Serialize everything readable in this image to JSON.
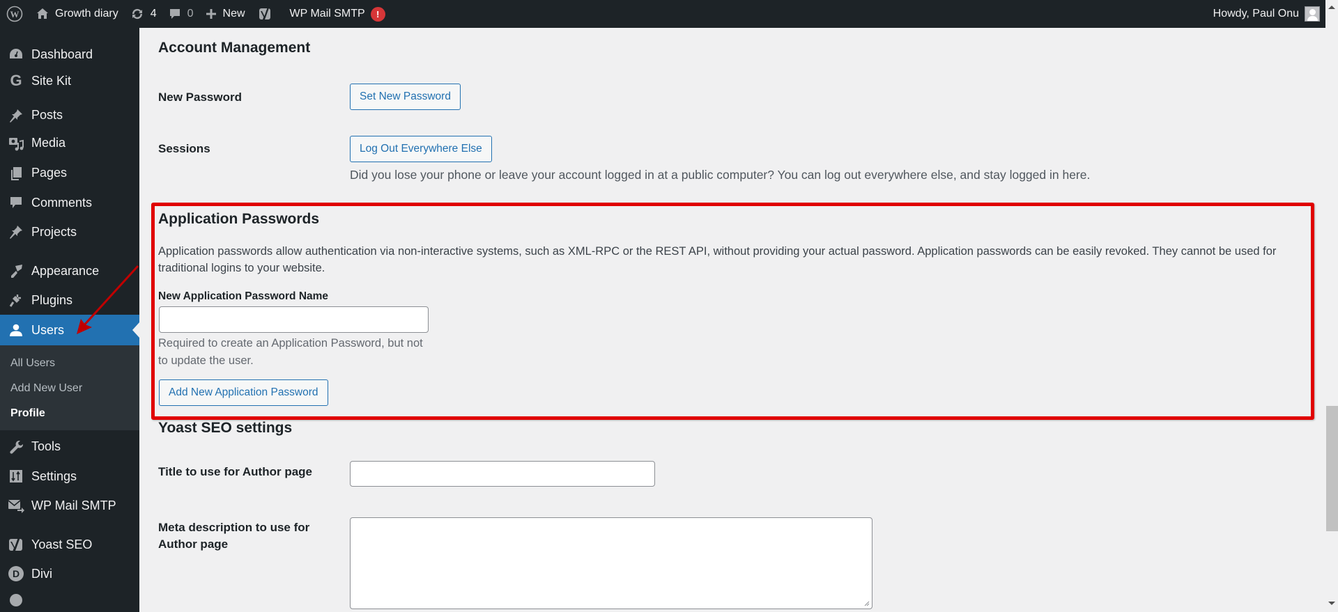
{
  "adminbar": {
    "site_name": "Growth diary",
    "updates_count": "4",
    "comments_count": "0",
    "new_label": "New",
    "plugin_label": "WP Mail SMTP",
    "plugin_badge": "!",
    "greeting": "Howdy, Paul Onu"
  },
  "sidebar": {
    "items": [
      {
        "label": "Dashboard",
        "icon": "dashboard-icon"
      },
      {
        "label": "Site Kit",
        "icon": "google-g-icon"
      },
      {
        "label": "Posts",
        "icon": "pushpin-icon"
      },
      {
        "label": "Media",
        "icon": "media-icon"
      },
      {
        "label": "Pages",
        "icon": "pages-icon"
      },
      {
        "label": "Comments",
        "icon": "comment-icon"
      },
      {
        "label": "Projects",
        "icon": "pushpin-icon"
      },
      {
        "label": "Appearance",
        "icon": "paintbrush-icon"
      },
      {
        "label": "Plugins",
        "icon": "plug-icon"
      },
      {
        "label": "Users",
        "icon": "user-icon",
        "current": true
      },
      {
        "label": "Tools",
        "icon": "wrench-icon"
      },
      {
        "label": "Settings",
        "icon": "sliders-icon"
      },
      {
        "label": "WP Mail SMTP",
        "icon": "mail-forward-icon"
      },
      {
        "label": "Yoast SEO",
        "icon": "yoast-icon"
      },
      {
        "label": "Divi",
        "icon": "divi-icon"
      }
    ],
    "users_submenu": [
      {
        "label": "All Users"
      },
      {
        "label": "Add New User"
      },
      {
        "label": "Profile",
        "current": true
      }
    ]
  },
  "account": {
    "title": "Account Management",
    "new_password_label": "New Password",
    "set_password_button": "Set New Password",
    "sessions_label": "Sessions",
    "logout_button": "Log Out Everywhere Else",
    "sessions_description": "Did you lose your phone or leave your account logged in at a public computer? You can log out everywhere else, and stay logged in here."
  },
  "app_passwords": {
    "title": "Application Passwords",
    "description": "Application passwords allow authentication via non-interactive systems, such as XML-RPC or the REST API, without providing your actual password. Application passwords can be easily revoked. They cannot be used for traditional logins to your website.",
    "name_label": "New Application Password Name",
    "name_value": "",
    "name_help": "Required to create an Application Password, but not to update the user.",
    "add_button": "Add New Application Password"
  },
  "yoast": {
    "title": "Yoast SEO settings",
    "author_title_label": "Title to use for Author page",
    "author_title_value": "",
    "meta_desc_label": "Meta description to use for Author page",
    "meta_desc_value": ""
  },
  "colors": {
    "accent": "#2271b1",
    "adminbar_bg": "#1d2327",
    "highlight": "#e00000",
    "badge": "#d63638"
  }
}
